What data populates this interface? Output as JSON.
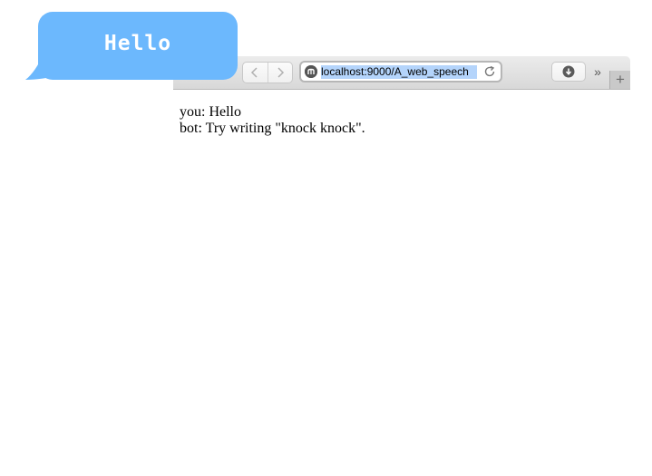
{
  "bubble": {
    "text": "Hello",
    "color": "#6cb8fd"
  },
  "browser": {
    "url": "localhost:9000/A_web_speech",
    "nav": {
      "back_icon": "chevron-left-icon",
      "forward_icon": "chevron-right-icon",
      "back_glyph": "〈",
      "forward_glyph": "〉"
    },
    "overflow_glyph": "»",
    "new_tab_glyph": "+"
  },
  "chat": {
    "lines": [
      {
        "speaker": "you",
        "text": "Hello"
      },
      {
        "speaker": "bot",
        "text": "Try writing \"knock knock\"."
      }
    ],
    "line_0": "you: Hello",
    "line_1": "bot: Try writing \"knock knock\"."
  }
}
